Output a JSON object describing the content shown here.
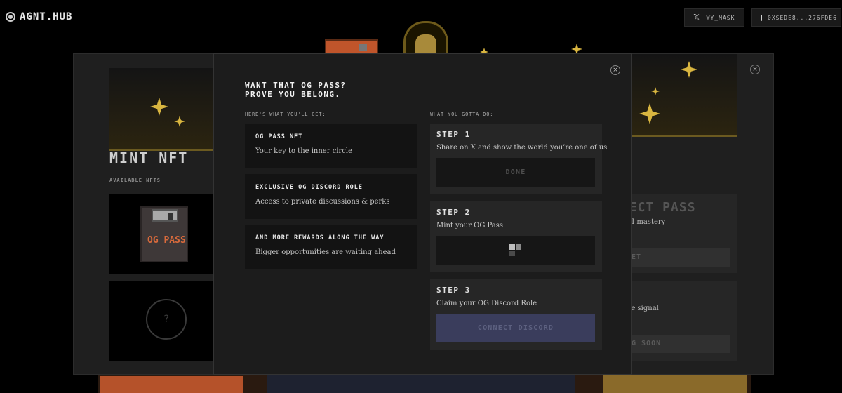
{
  "app": {
    "logo_text": "AGNT.HUB",
    "x_handle": "WY_MASK",
    "wallet_address": "0XSEDE8...276FDE6"
  },
  "mint_panel": {
    "title": "MINT NFT",
    "available_label": "AVAILABLE NFTS",
    "nft_card_text": "OG PASS",
    "mystery_glyph": "?"
  },
  "right_panel": {
    "card1_title": "NECT PASS",
    "card1_desc": "AI mastery",
    "card1_button": "SET",
    "card2_desc": "he signal",
    "card2_button": "NG SOON",
    "close_glyph": "×"
  },
  "modal": {
    "close_glyph": "×",
    "headline_line1": "WANT THAT OG PASS?",
    "headline_line2": "PROVE YOU BELONG.",
    "perks_label": "HERE'S WHAT YOU'LL GET:",
    "steps_label": "WHAT YOU GOTTA DO:",
    "perks": [
      {
        "title": "OG PASS NFT",
        "desc": "Your key to the inner circle"
      },
      {
        "title": "EXCLUSIVE OG DISCORD ROLE",
        "desc": "Access to private discussions & perks"
      },
      {
        "title": "AND MORE REWARDS ALONG THE WAY",
        "desc": "Bigger opportunities are waiting ahead"
      }
    ],
    "steps": [
      {
        "title": "STEP 1",
        "desc": "Share on X and show the world you’re one of us",
        "button": "DONE"
      },
      {
        "title": "STEP 2",
        "desc": "Mint your OG Pass",
        "button": ""
      },
      {
        "title": "STEP 3",
        "desc": "Claim your OG Discord Role",
        "button": "CONNECT DISCORD"
      }
    ]
  },
  "colors": {
    "accent_gold": "#d9b640",
    "discord_button": "#3a3d5c",
    "modal_bg": "#1c1c1c"
  },
  "icons": [
    "logo-icon",
    "x-icon",
    "wallet-icon",
    "close-icon",
    "loading-icon",
    "sparkle-icon"
  ]
}
